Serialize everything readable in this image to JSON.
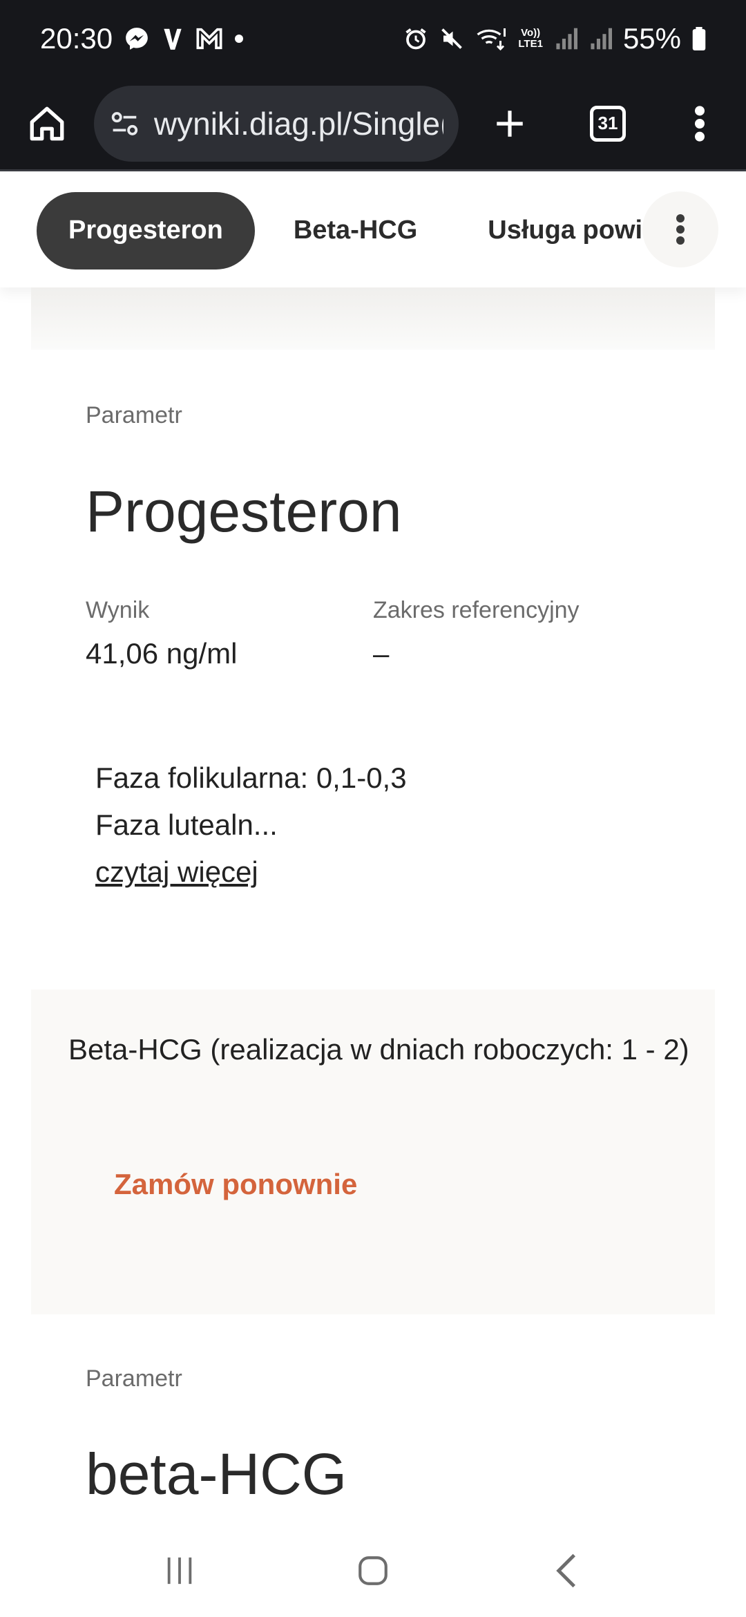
{
  "status_bar": {
    "time": "20:30",
    "battery": "55%",
    "network_label": "LTE1"
  },
  "browser": {
    "url": "wyniki.diag.pl/Single(",
    "tab_count": "31"
  },
  "chips": [
    {
      "label": "Progesteron",
      "active": true
    },
    {
      "label": "Beta-HCG",
      "active": false
    },
    {
      "label": "Usługa powia",
      "active": false
    }
  ],
  "result1": {
    "param_label": "Parametr",
    "name": "Progesteron",
    "result_label": "Wynik",
    "result_value": "41,06 ng/ml",
    "ref_label": "Zakres referencyjny",
    "ref_value": "–",
    "desc_line1": "Faza folikularna: 0,1-0,3",
    "desc_line2": "Faza lutealn...",
    "read_more": "czytaj więcej"
  },
  "order": {
    "title": "Beta-HCG (realizacja w dniach roboczych: 1 - 2)",
    "button": "Zamów ponownie",
    "button_color": "#d4643c"
  },
  "result2": {
    "param_label": "Parametr",
    "name": "beta-HCG"
  }
}
